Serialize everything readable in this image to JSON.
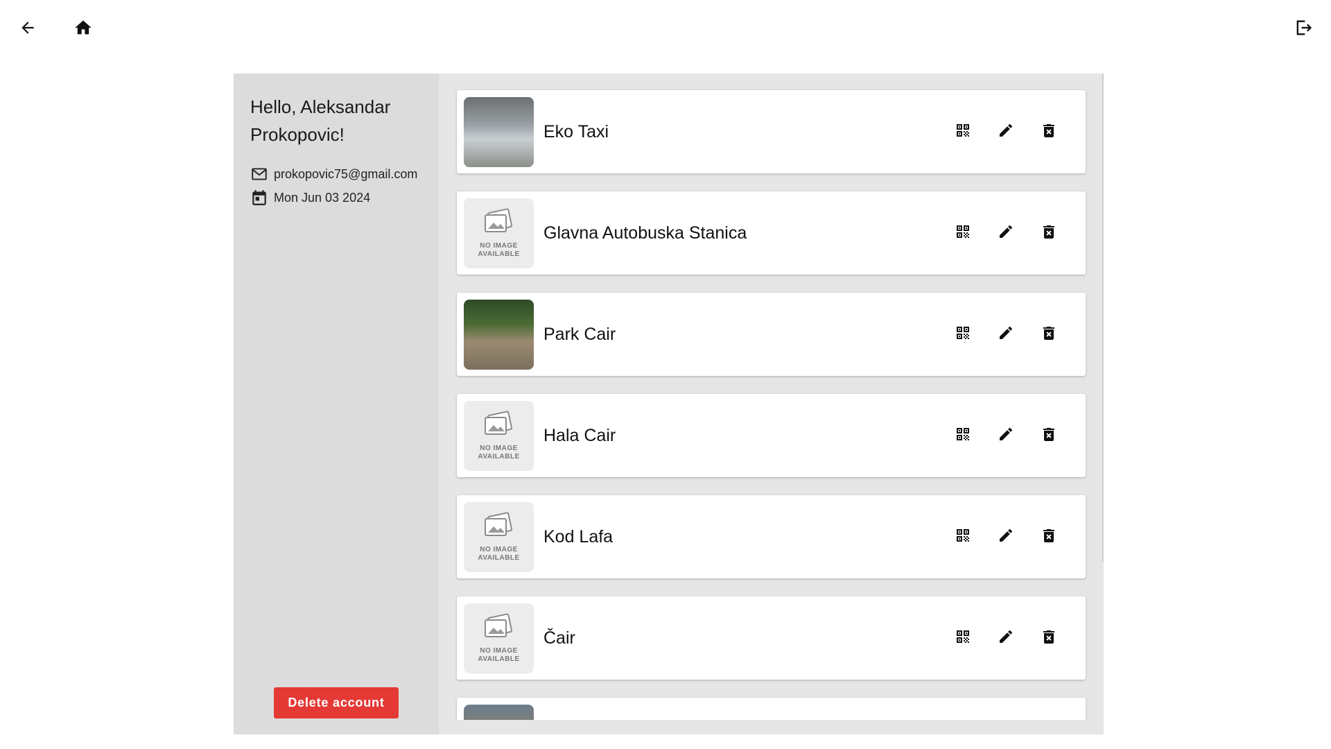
{
  "nav": {
    "back_icon": "arrow-back-icon",
    "home_icon": "home-icon",
    "logout_icon": "logout-icon"
  },
  "profile": {
    "greeting": "Hello, Aleksandar Prokopovic!",
    "email": "prokopovic75@gmail.com",
    "date": "Mon Jun 03 2024",
    "delete_label": "Delete account"
  },
  "places": [
    {
      "name": "Eko Taxi",
      "image": "photo"
    },
    {
      "name": "Glavna Autobuska Stanica",
      "image": "none"
    },
    {
      "name": "Park Cair",
      "image": "photo"
    },
    {
      "name": "Hala Cair",
      "image": "none"
    },
    {
      "name": "Kod Lafa",
      "image": "none"
    },
    {
      "name": "Čair",
      "image": "none"
    },
    {
      "name": "",
      "image": "photo"
    }
  ],
  "no_image_text": {
    "line1": "NO IMAGE",
    "line2": "AVAILABLE"
  },
  "colors": {
    "danger": "#e53935",
    "panel": "#e6e6e6",
    "sidebar": "#dcdcdc"
  }
}
